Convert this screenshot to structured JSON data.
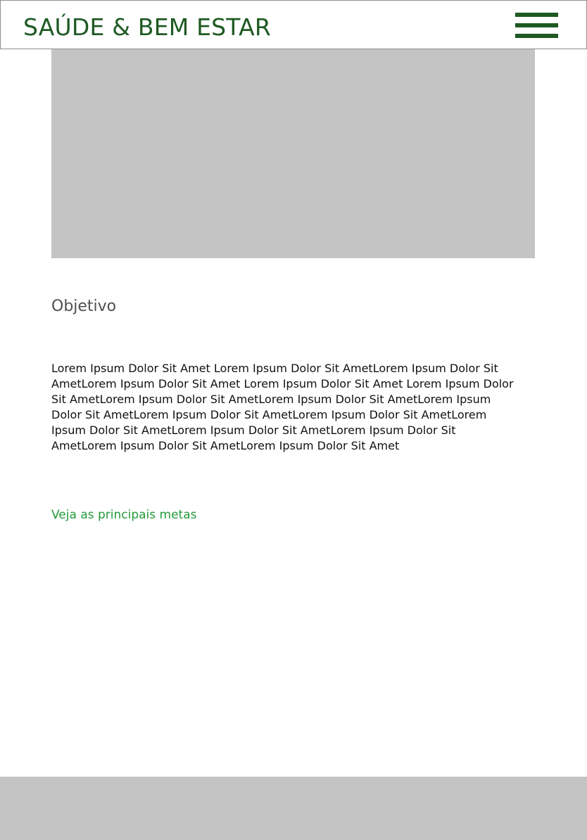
{
  "header": {
    "site_title": "SAÚDE & BEM ESTAR",
    "menu_icon": "hamburger-menu-icon"
  },
  "main": {
    "section_title": "Objetivo",
    "body_text": "Lorem Ipsum Dolor Sit Amet Lorem Ipsum Dolor Sit AmetLorem Ipsum Dolor Sit AmetLorem Ipsum Dolor Sit Amet Lorem Ipsum Dolor Sit Amet Lorem Ipsum Dolor Sit AmetLorem Ipsum Dolor Sit AmetLorem Ipsum Dolor Sit AmetLorem Ipsum Dolor Sit AmetLorem Ipsum Dolor Sit AmetLorem Ipsum Dolor Sit AmetLorem Ipsum Dolor Sit AmetLorem Ipsum Dolor Sit AmetLorem Ipsum Dolor Sit AmetLorem Ipsum Dolor Sit AmetLorem Ipsum Dolor Sit Amet",
    "link_text": "Veja as principais metas"
  },
  "colors": {
    "brand_green": "#1e5a23",
    "link_green": "#229a3a",
    "placeholder_gray": "#c4c4c4"
  }
}
